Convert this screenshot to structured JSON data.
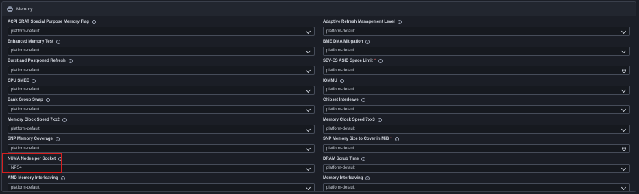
{
  "section": {
    "title": "Memory"
  },
  "left_fields": [
    {
      "label": "ACPI SRAT Special Purpose Memory Flag",
      "value": "platform-default",
      "info": true,
      "required": false,
      "control": "chevron"
    },
    {
      "label": "Enhanced Memory Test",
      "value": "platform-default",
      "info": true,
      "required": false,
      "control": "chevron"
    },
    {
      "label": "Burst and Postponed Refresh",
      "value": "platform-default",
      "info": true,
      "required": false,
      "control": "chevron"
    },
    {
      "label": "CPU SMEE",
      "value": "platform-default",
      "info": true,
      "required": false,
      "control": "chevron"
    },
    {
      "label": "Bank Group Swap",
      "value": "platform-default",
      "info": true,
      "required": false,
      "control": "chevron"
    },
    {
      "label": "Memory Clock Speed 7xx2",
      "value": "platform-default",
      "info": true,
      "required": false,
      "control": "chevron"
    },
    {
      "label": "SNP Memory Coverage",
      "value": "platform-default",
      "info": true,
      "required": false,
      "control": "chevron"
    },
    {
      "label": "NUMA Nodes per Socket",
      "value": "NPS4",
      "info": true,
      "required": false,
      "control": "chevron"
    },
    {
      "label": "AMD Memory Interleaving",
      "value": "platform-default",
      "info": true,
      "required": false,
      "control": "chevron"
    }
  ],
  "right_fields": [
    {
      "label": "Adaptive Refresh Management Level",
      "value": "platform-default",
      "info": true,
      "required": false,
      "control": "chevron"
    },
    {
      "label": "BME DMA Mitigation",
      "value": "platform-default",
      "info": true,
      "required": false,
      "control": "chevron"
    },
    {
      "label": "SEV-ES ASID Space Limit",
      "value": "platform-default",
      "info": true,
      "required": true,
      "control": "clear"
    },
    {
      "label": "IOMMU",
      "value": "platform-default",
      "info": true,
      "required": false,
      "control": "chevron"
    },
    {
      "label": "Chipset Interleave",
      "value": "platform-default",
      "info": true,
      "required": false,
      "control": "chevron"
    },
    {
      "label": "Memory Clock Speed 7xx3",
      "value": "platform-default",
      "info": true,
      "required": false,
      "control": "chevron"
    },
    {
      "label": "SNP Memory Size to Cover in MiB",
      "value": "platform-default",
      "info": true,
      "required": true,
      "control": "clear"
    },
    {
      "label": "DRAM Scrub Time",
      "value": "platform-default",
      "info": true,
      "required": false,
      "control": "chevron"
    },
    {
      "label": "Memory Interleaving",
      "value": "platform-default",
      "info": true,
      "required": false,
      "control": "chevron"
    }
  ],
  "icons": {
    "collapse": "minus-circle-icon",
    "info": "info-circle-icon",
    "dropdown": "chevron-down-icon",
    "clear": "clear-circle-icon"
  },
  "colors": {
    "background": "#1b1e26",
    "highlight": "#d61f1f",
    "required": "#e26a6a"
  }
}
